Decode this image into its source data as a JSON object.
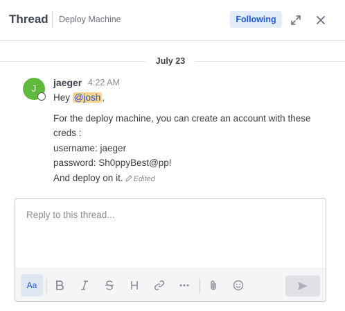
{
  "header": {
    "title": "Thread",
    "channel": "Deploy Machine",
    "following_label": "Following",
    "expand_icon": "expand-icon",
    "close_icon": "close-icon"
  },
  "date_separator": "July 23",
  "post": {
    "avatar_initial": "J",
    "avatar_color": "#5fb93c",
    "author": "jaeger",
    "time": "4:22 AM",
    "greeting_prefix": "Hey ",
    "mention": "@josh",
    "greeting_suffix": ",",
    "lines": [
      "For the deploy machine, you can create an account with these",
      "creds :",
      "username: jaeger",
      "password: Sh0ppyBest@pp!"
    ],
    "last_line": "And deploy on it.",
    "edited_label": "Edited"
  },
  "composer": {
    "placeholder": "Reply to this thread...",
    "format_toggle": "Aa",
    "tools": [
      "bold-icon",
      "italic-icon",
      "strikethrough-icon",
      "heading-icon",
      "link-icon",
      "more-icon",
      "attachment-icon",
      "emoji-icon",
      "send-icon"
    ]
  },
  "colors": {
    "accent": "#1c58d9",
    "mention_highlight": "#ffd38a",
    "following_bg": "#e3edf9"
  }
}
